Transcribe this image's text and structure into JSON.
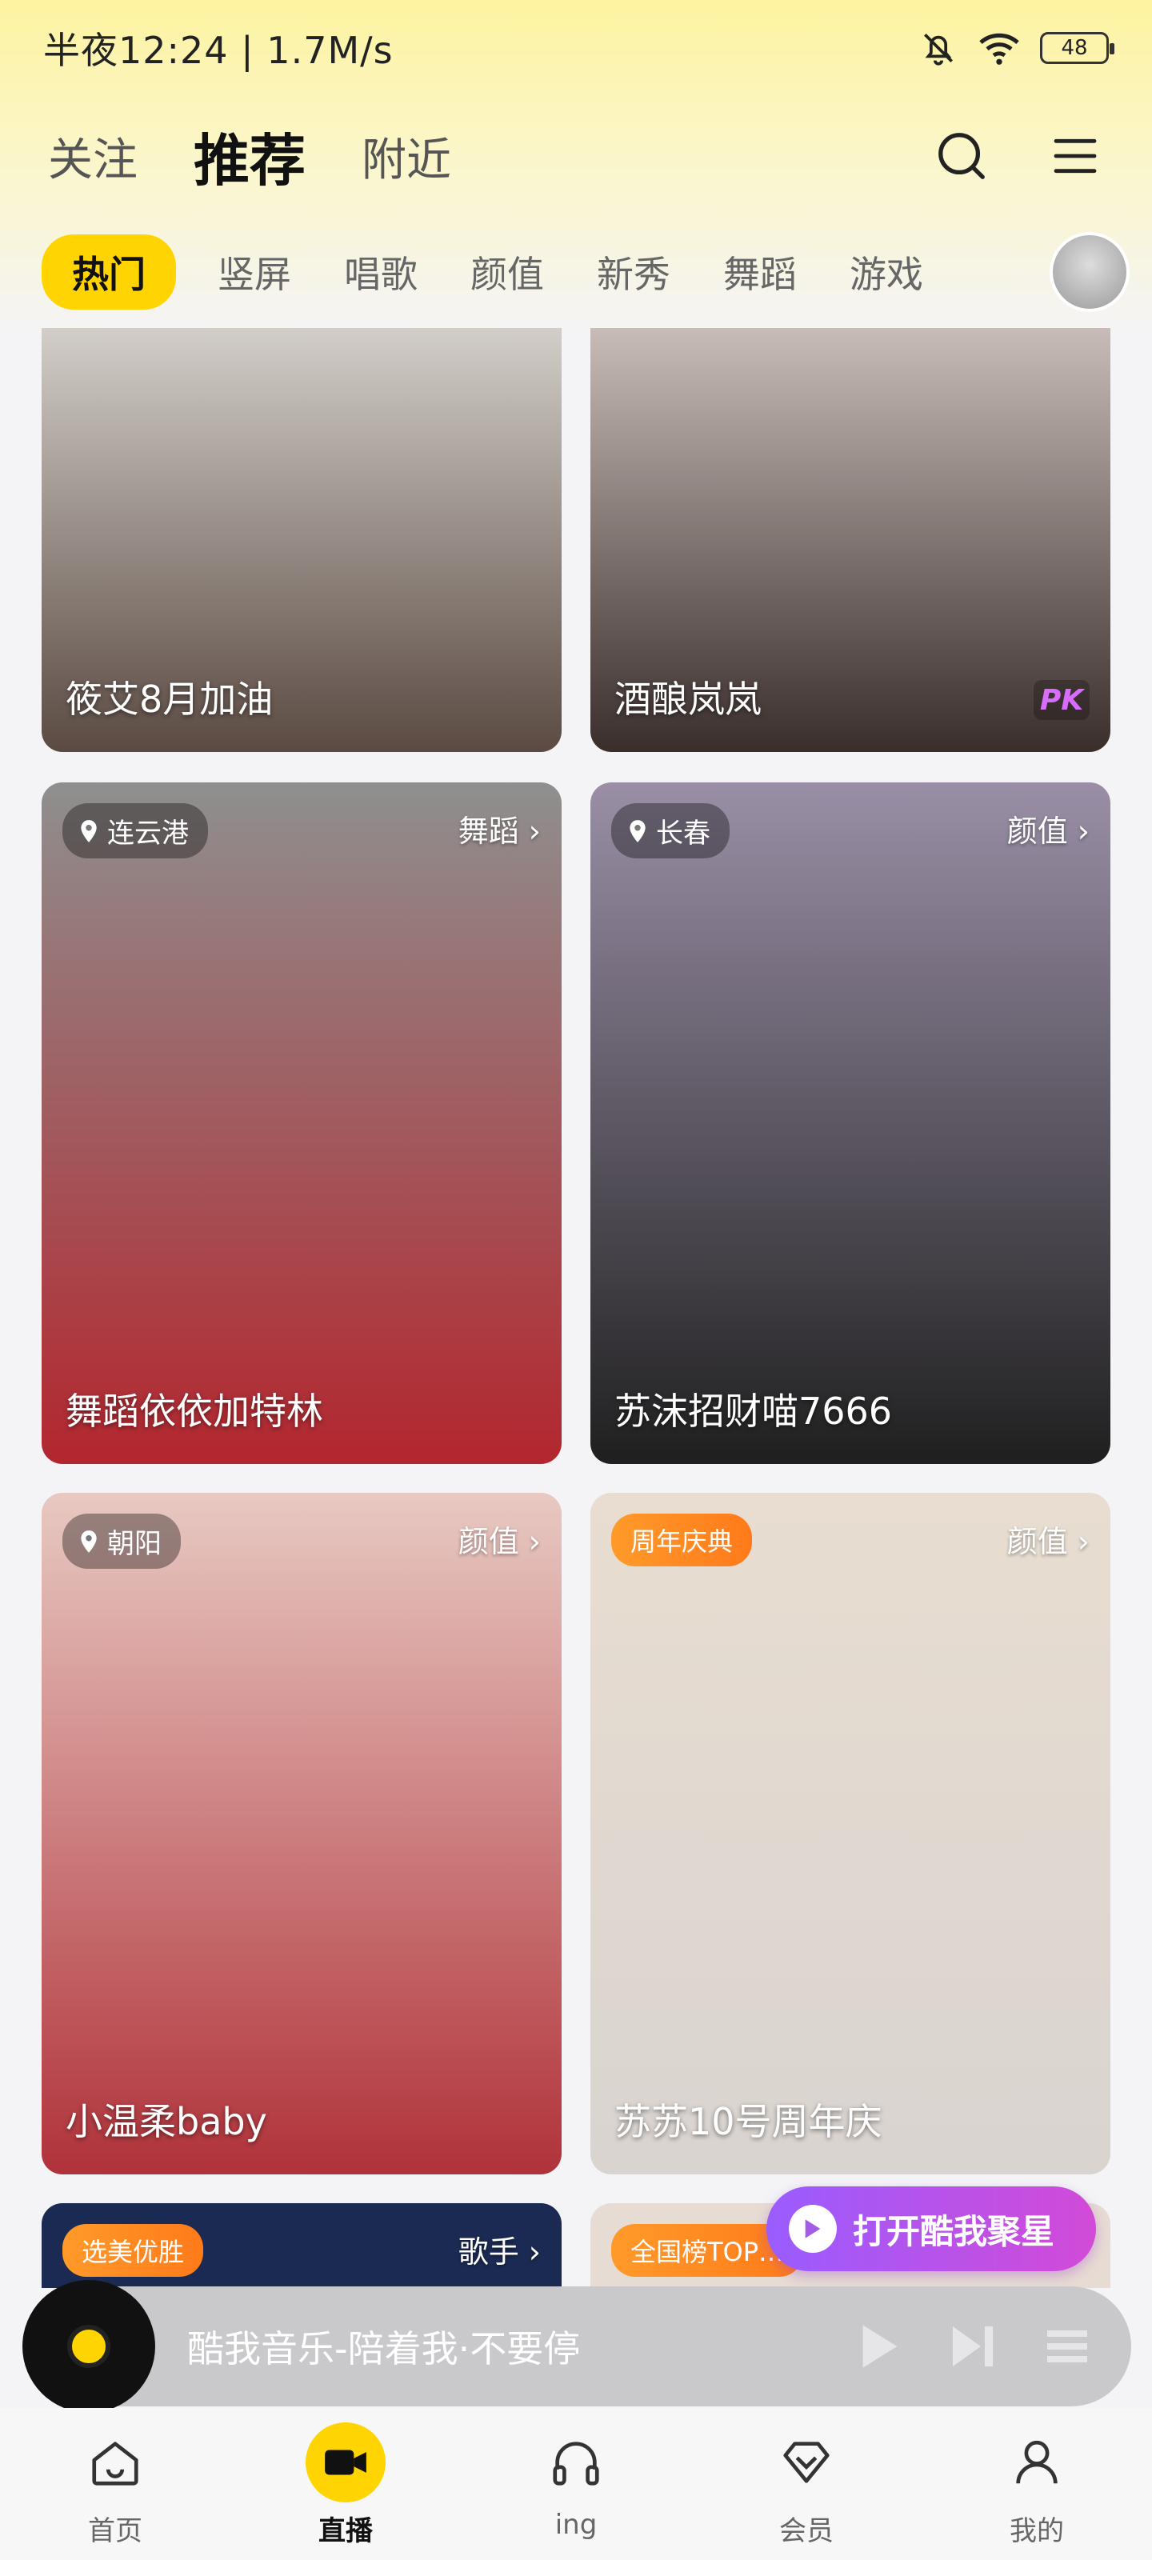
{
  "status_bar": {
    "time": "半夜12:24 | 1.7M/s",
    "battery": "48"
  },
  "header": {
    "tabs": [
      {
        "label": "关注",
        "active": false
      },
      {
        "label": "推荐",
        "active": true
      },
      {
        "label": "附近",
        "active": false
      }
    ],
    "search_icon": "search-icon",
    "menu_icon": "menu-icon"
  },
  "categories": [
    "热门",
    "竖屏",
    "唱歌",
    "颜值",
    "新秀",
    "舞蹈",
    "游戏"
  ],
  "cards": [
    {
      "name": "筱艾8月加油",
      "location": "",
      "tag": "",
      "badge": "",
      "pk": "",
      "color_top": "#d9d5d0",
      "color_bottom": "#5a4a42"
    },
    {
      "name": "酒酿岚岚",
      "location": "",
      "tag": "",
      "badge": "",
      "pk": "PK",
      "color_top": "#cfc4bf",
      "color_bottom": "#3a2e2c"
    },
    {
      "name": "舞蹈依依加特林",
      "location": "连云港",
      "tag": "舞蹈 ›",
      "badge": "",
      "pk": "",
      "color_top": "#8f8f8f",
      "color_bottom": "#b3262e"
    },
    {
      "name": "苏沫招财喵7666",
      "location": "长春",
      "tag": "颜值 ›",
      "badge": "",
      "pk": "",
      "color_top": "#9a8fa6",
      "color_bottom": "#1f1f1f"
    },
    {
      "name": "小温柔baby",
      "location": "朝阳",
      "tag": "颜值 ›",
      "badge": "",
      "pk": "",
      "color_top": "#e8c9c2",
      "color_bottom": "#b0323a"
    },
    {
      "name": "苏苏10号周年庆",
      "location": "",
      "tag": "颜值 ›",
      "badge": "周年庆典",
      "pk": "",
      "color_top": "#e8ddd0",
      "color_bottom": "#d9d4d0"
    },
    {
      "name": "",
      "location": "",
      "tag": "歌手 ›",
      "badge": "选美优胜",
      "pk": "",
      "color_top": "#1b2a52",
      "color_bottom": "#1b2a52"
    },
    {
      "name": "",
      "location": "",
      "tag": "",
      "badge": "全国榜TOP…",
      "pk": "",
      "color_top": "#e7dcd3",
      "color_bottom": "#e7dcd3"
    }
  ],
  "open_app_button": "打开酷我聚星",
  "player": {
    "title": "酷我音乐-陪着我·不要停"
  },
  "bottom_nav": [
    {
      "label": "首页",
      "icon": "home-icon",
      "active": false
    },
    {
      "label": "直播",
      "icon": "video-camera-icon",
      "active": true
    },
    {
      "label": "ing",
      "icon": "headphones-icon",
      "active": false
    },
    {
      "label": "会员",
      "icon": "diamond-icon",
      "active": false
    },
    {
      "label": "我的",
      "icon": "profile-icon",
      "active": false
    }
  ]
}
